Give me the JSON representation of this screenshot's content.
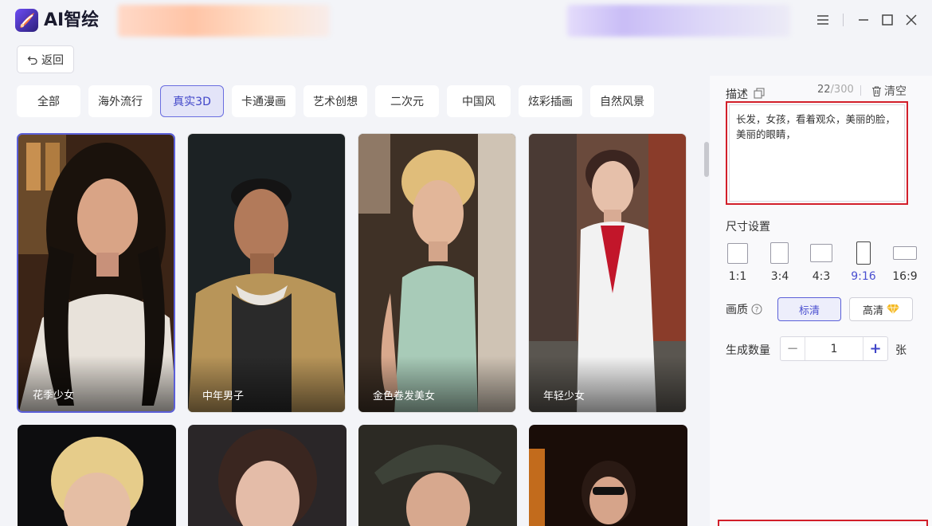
{
  "app": {
    "title": "AI智绘"
  },
  "toolbar": {
    "back_label": "返回"
  },
  "tabs": [
    {
      "label": "全部",
      "active": false
    },
    {
      "label": "海外流行",
      "active": false
    },
    {
      "label": "真实3D",
      "active": true
    },
    {
      "label": "卡通漫画",
      "active": false
    },
    {
      "label": "艺术创想",
      "active": false
    },
    {
      "label": "二次元",
      "active": false
    },
    {
      "label": "中国风",
      "active": false
    },
    {
      "label": "炫彩插画",
      "active": false
    },
    {
      "label": "自然风景",
      "active": false
    }
  ],
  "gallery": {
    "items": [
      {
        "caption": "花季少女",
        "selected": true
      },
      {
        "caption": "中年男子",
        "selected": false
      },
      {
        "caption": "金色卷发美女",
        "selected": false
      },
      {
        "caption": "年轻少女",
        "selected": false
      }
    ]
  },
  "panel": {
    "description_label": "描述",
    "char_count": "22",
    "char_max": "/300",
    "clear_label": "清空",
    "description_text": "长发，女孩，看着观众，美丽的脸，美丽的眼睛，",
    "size_label": "尺寸设置",
    "sizes": [
      {
        "label": "1:1",
        "active": false
      },
      {
        "label": "3:4",
        "active": false
      },
      {
        "label": "4:3",
        "active": false
      },
      {
        "label": "9:16",
        "active": true
      },
      {
        "label": "16:9",
        "active": false
      }
    ],
    "quality_label": "画质",
    "quality_options": [
      {
        "label": "标清",
        "active": true
      },
      {
        "label": "高清",
        "active": false
      }
    ],
    "count_label": "生成数量",
    "count_value": "1",
    "count_unit": "张"
  },
  "colors": {
    "accent": "#4a4fd0",
    "highlight_border": "#d21f2a"
  }
}
